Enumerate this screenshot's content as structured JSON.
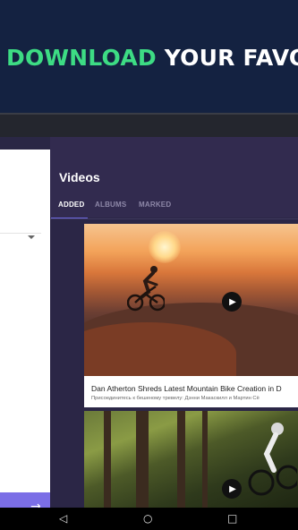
{
  "banner": {
    "text_highlight": "DOWNLOAD",
    "text_rest": "YOUR FAVOU"
  },
  "app": {
    "section_title": "Videos",
    "tabs": [
      {
        "label": "ADDED",
        "active": true
      },
      {
        "label": "ALBUMS",
        "active": false
      },
      {
        "label": "MARKED",
        "active": false
      }
    ],
    "videos": [
      {
        "title": "Dan Atherton Shreds Latest Mountain Bike Creation in D",
        "subtitle": "Присоединитесь к бешеному тревелу: Дэнни Макаскилл и Мартин Сё",
        "icon": "play-icon"
      },
      {
        "title": "",
        "subtitle": "",
        "icon": "play-icon"
      }
    ]
  },
  "left_panel": {
    "dropdown_icon": "chevron-down-icon",
    "action_icon": "arrow-right-icon"
  },
  "navbar": {
    "back_icon": "back-icon",
    "home_icon": "home-icon",
    "recents_icon": "recents-icon",
    "back_glyph": "◁",
    "home_glyph": "○",
    "recents_glyph": "□"
  },
  "colors": {
    "banner_bg": "#142241",
    "banner_accent": "#3ddc84",
    "app_bg": "#2b2646",
    "tab_accent": "#6d68e0",
    "action_button": "#7b6ee6"
  }
}
